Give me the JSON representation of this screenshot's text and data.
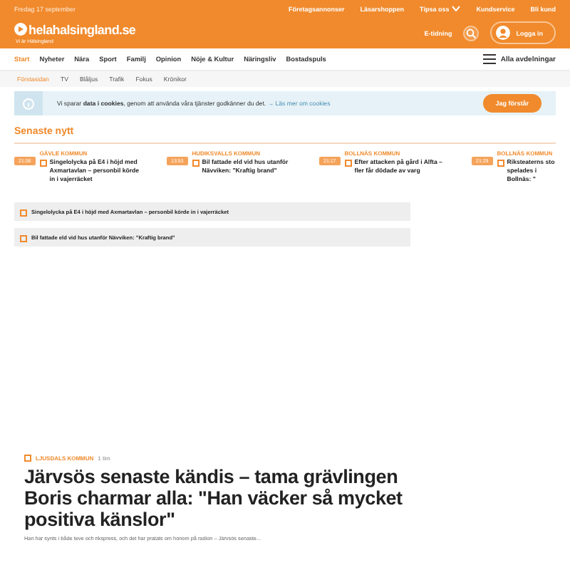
{
  "top_bar": {
    "date": "Fredag 17 september",
    "links": [
      {
        "label": "Företagsannonser"
      },
      {
        "label": "Läsarshoppen"
      },
      {
        "label": "Tipsa oss",
        "dropdown": true
      },
      {
        "label": "Kundservice"
      },
      {
        "label": "Bli kund"
      }
    ]
  },
  "header": {
    "logo": "helahalsingland.se",
    "tagline": "Vi är Hälsingland",
    "etidning": "E-tidning",
    "login": "Logga in"
  },
  "nav": {
    "items": [
      {
        "label": "Start",
        "selected": true
      },
      {
        "label": "Nyheter",
        "selected": false
      },
      {
        "label": "Nära",
        "selected": false
      },
      {
        "label": "Sport",
        "selected": false
      },
      {
        "label": "Familj",
        "selected": false
      },
      {
        "label": "Opinion",
        "selected": false
      },
      {
        "label": "Nöje & Kultur",
        "selected": false
      },
      {
        "label": "Näringsliv",
        "selected": false
      },
      {
        "label": "Bostadspuls",
        "selected": false
      }
    ],
    "all": "Alla avdelningar"
  },
  "subnav": {
    "items": [
      {
        "label": "Förstasidan",
        "selected": true
      },
      {
        "label": "TV",
        "selected": false
      },
      {
        "label": "Blåljus",
        "selected": false
      },
      {
        "label": "Trafik",
        "selected": false
      },
      {
        "label": "Fokus",
        "selected": false
      },
      {
        "label": "Krönikor",
        "selected": false
      }
    ]
  },
  "cookie": {
    "text": "Vi sparar **data i cookies**, genom att använda våra tjänster godkänner du det.",
    "link": "→ Läs mer om cookies",
    "button": "Jag förstår"
  },
  "latest": {
    "title": "Senaste nytt",
    "items": [
      {
        "time": "21:06",
        "section": "GÄVLE KOMMUN",
        "title": "Singelolycka på E4 i höjd med Axmartavlan – personbil körde in i vajerräcket"
      },
      {
        "time": "13:53",
        "section": "HUDIKSVALLS KOMMUN",
        "title": "Bil fattade eld vid hus utanför Nävviken: \"Kraftig brand\""
      },
      {
        "time": "21:17",
        "section": "BOLLNÄS KOMMUN",
        "title": "Efter attacken på gård i Alfta – fler får dödade av varg"
      },
      {
        "time": "21:29",
        "section": "BOLLNÄS KOMMUN",
        "title": "Riksteaterns sto spelades i Bollnäs: \""
      }
    ]
  },
  "teasers": [
    {
      "title": "Singelolycka på E4 i höjd med Axmartavlan – personbil körde in i vajerräcket"
    },
    {
      "title": "Bil fattade eld vid hus utanför Nävviken: \"Kraftig brand\""
    }
  ],
  "article": {
    "section": "LJUSDALS KOMMUN",
    "age": "1 tim",
    "headline": "Järvsös senaste kändis – tama grävlingen Boris charmar alla: \"Han väcker så mycket positiva känslor\"",
    "summary": "Han har synts i både teve och rikspress, och det har pratats om honom på radion – Järvsös senaste..."
  }
}
